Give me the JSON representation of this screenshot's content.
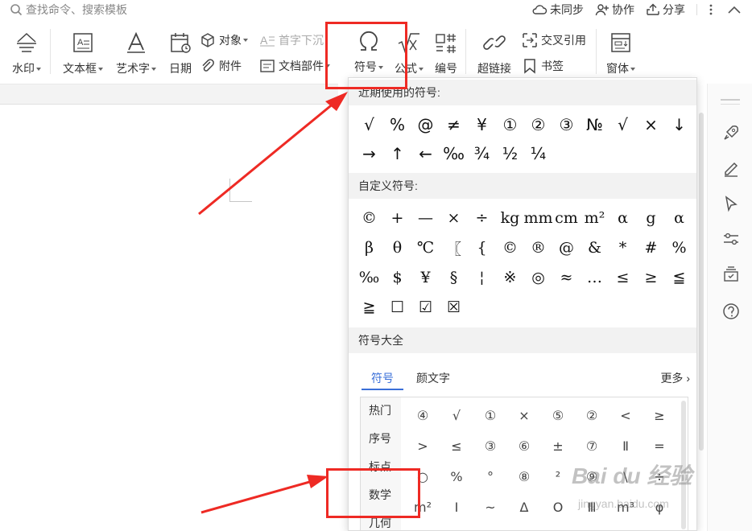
{
  "topbar": {
    "search_placeholder": "查找命令、搜索模板",
    "sync_label": "未同步",
    "collab_label": "协作",
    "share_label": "分享"
  },
  "ribbon": {
    "watermark": "水印",
    "textbox": "文本框",
    "wordart": "艺术字",
    "date": "日期",
    "object": "对象",
    "dropcap": "首字下沉",
    "attachment": "附件",
    "docparts": "文档部件",
    "symbol": "符号",
    "formula": "公式",
    "numbering": "编号",
    "hyperlink": "超链接",
    "crossref": "交叉引用",
    "bookmark": "书签",
    "window": "窗体"
  },
  "dropdown": {
    "recent_title": "近期使用的符号:",
    "recent": [
      "√",
      "%",
      "@",
      "≠",
      "¥",
      "①",
      "②",
      "③",
      "№",
      "√",
      "×",
      "↓",
      "→",
      "↑",
      "←",
      "‰",
      "¾",
      "½",
      "¼"
    ],
    "custom_title": "自定义符号:",
    "custom": [
      "©",
      "+",
      "—",
      "×",
      "÷",
      "kg",
      "mm",
      "cm",
      "m²",
      "α",
      "g",
      "α",
      "β",
      "θ",
      "℃",
      "〖",
      "{",
      "©",
      "®",
      "@",
      "&",
      "*",
      "#",
      "%",
      "‰",
      "$",
      "¥",
      "§",
      "¦",
      "※",
      "◎",
      "≈",
      "…",
      "≤",
      "≥",
      "≦",
      "≧",
      "☐",
      "☑",
      "☒"
    ],
    "library_title": "符号大全",
    "tab_symbol": "符号",
    "tab_kaomoji": "颜文字",
    "more": "更多",
    "categories": [
      "热门",
      "序号",
      "标点",
      "数学",
      "几何"
    ],
    "library": [
      "④",
      "√",
      "①",
      "×",
      "⑤",
      "②",
      "<",
      "≥",
      ">",
      "≤",
      "③",
      "⑥",
      "±",
      "⑦",
      "Ⅱ",
      "=",
      "○",
      "%",
      "°",
      "⑧",
      "²",
      "⑨",
      "\\",
      "÷",
      "m²",
      "Ⅰ",
      "~",
      "Δ",
      "O",
      "Ⅲ",
      "m³",
      "φ"
    ]
  },
  "colors": {
    "annotation": "#ee2a24",
    "accent": "#3a6fd8"
  },
  "watermark": {
    "brand": "Bai du 经验",
    "url": "jingyan.baidu.com"
  }
}
